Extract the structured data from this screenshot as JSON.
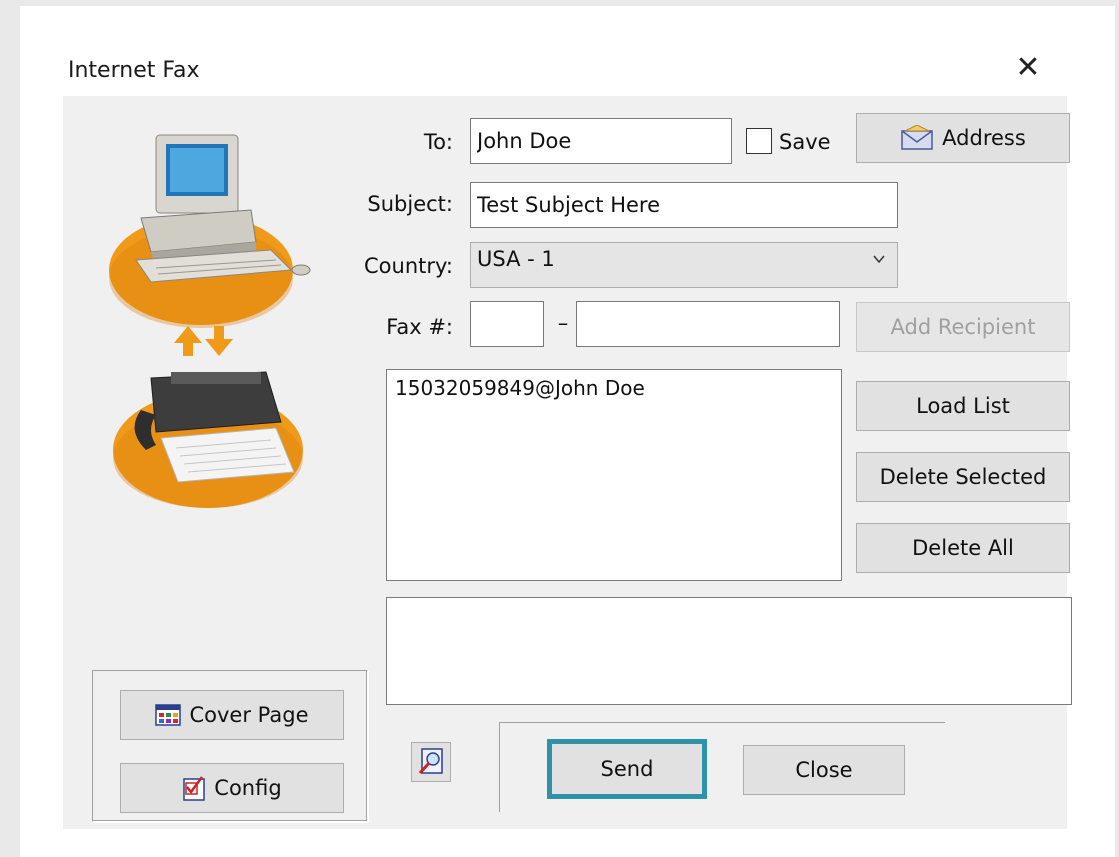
{
  "window": {
    "title": "Internet Fax",
    "close_icon": "close-x-icon"
  },
  "form": {
    "to_label": "To:",
    "to_value": "John Doe",
    "save_label": "Save",
    "save_checked": false,
    "subject_label": "Subject:",
    "subject_value": "Test Subject Here",
    "country_label": "Country:",
    "country_value": "USA - 1",
    "fax_label": "Fax #:",
    "fax_area": "",
    "fax_dash": "–",
    "fax_number": ""
  },
  "buttons": {
    "address": "Address",
    "address_icon": "envelope-icon",
    "add_recipient": "Add Recipient",
    "load_list": "Load List",
    "delete_selected": "Delete Selected",
    "delete_all": "Delete All",
    "cover_page": "Cover Page",
    "cover_page_icon": "grid-icon",
    "config": "Config",
    "config_icon": "checklist-icon",
    "preview_icon": "magnifier-page-icon",
    "send": "Send",
    "close": "Close"
  },
  "recipients": [
    "15032059849@John Doe"
  ],
  "message": "",
  "colors": {
    "dialog_bg": "#f0f0f0",
    "button_bg": "#e1e1e1",
    "send_focus_border": "#2e93a8",
    "illustration_orange": "#f09a1a"
  }
}
